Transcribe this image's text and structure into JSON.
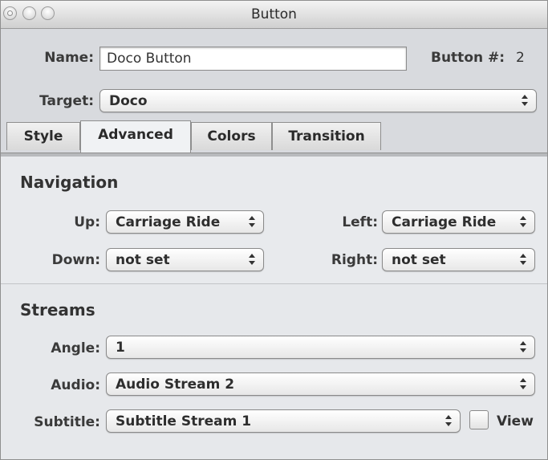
{
  "window": {
    "title": "Button"
  },
  "header": {
    "name_label": "Name:",
    "name_value": "Doco Button",
    "button_num_label": "Button #:",
    "button_num_value": "2",
    "target_label": "Target:",
    "target_value": "Doco"
  },
  "tabs": [
    {
      "label": "Style",
      "active": false
    },
    {
      "label": "Advanced",
      "active": true
    },
    {
      "label": "Colors",
      "active": false
    },
    {
      "label": "Transition",
      "active": false
    }
  ],
  "navigation": {
    "title": "Navigation",
    "up_label": "Up:",
    "up_value": "Carriage Ride",
    "left_label": "Left:",
    "left_value": "Carriage Ride",
    "down_label": "Down:",
    "down_value": "not set",
    "right_label": "Right:",
    "right_value": "not set"
  },
  "streams": {
    "title": "Streams",
    "angle_label": "Angle:",
    "angle_value": "1",
    "audio_label": "Audio:",
    "audio_value": "Audio Stream 2",
    "subtitle_label": "Subtitle:",
    "subtitle_value": "Subtitle Stream 1",
    "view_label": "View",
    "view_checked": false
  }
}
